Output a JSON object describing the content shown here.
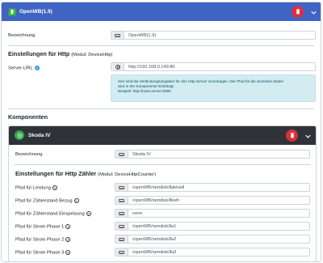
{
  "device": {
    "title": "OpenWB(1.9)",
    "bezeichnung_label": "Bezeichnung",
    "bezeichnung_value": "OpenWB(1.9)",
    "http_section_title": "Einstellungen für Http",
    "http_section_module": "(Modul: DeviceHttp)",
    "server_url_label": "Server-URL",
    "server_url_value": "http://192.168.0.149:80",
    "info_line1": "Hier sind die Verbindungsangaben für den Http-Server einzutragen. Der Pfad für die einzelnen Daten",
    "info_line2": "wird in der Komponente hinterlegt.",
    "info_line3": "Beispiel: http://mein.server:8080"
  },
  "components": {
    "title": "Komponenten",
    "component": {
      "title": "Skoda IV",
      "bezeichnung_label": "Bezeichnung",
      "bezeichnung_value": "Skoda IV",
      "section_title": "Einstellungen für Http Zähler",
      "section_module": "(Modul: DeviceHttpCounter)",
      "fields": [
        {
          "label": "Pfad für Leistung",
          "value": "/openWB/ramdisk/llaktuell",
          "help": true
        },
        {
          "label": "Pfad für Zählerstand Bezug",
          "value": "/openWB/ramdisk/llkwh",
          "help": true
        },
        {
          "label": "Pfad für Zählerstand Einspeisung",
          "value": "none",
          "help": true
        },
        {
          "label": "Pfad für Strom Phase 1",
          "value": "/openWB/ramdisk/lla1",
          "help": true
        },
        {
          "label": "Pfad für Strom Phase 2",
          "value": "/openWB/ramdisk/lla2",
          "help": true
        },
        {
          "label": "Pfad für Strom Phase 3",
          "value": "/openWB/ramdisk/lla3",
          "help": true
        }
      ]
    }
  },
  "colors": {
    "header_blue": "#3f64c4",
    "component_header": "#2f3238",
    "danger": "#d9303e",
    "success": "#2ea84a",
    "info_bg": "#d2ecf2"
  },
  "icons": {
    "device": "charging-station-icon",
    "delete": "trash-icon",
    "collapse": "chevron-down-icon",
    "text_field": "keyboard-icon",
    "url_field": "globe-icon",
    "help": "question-circle-icon"
  }
}
